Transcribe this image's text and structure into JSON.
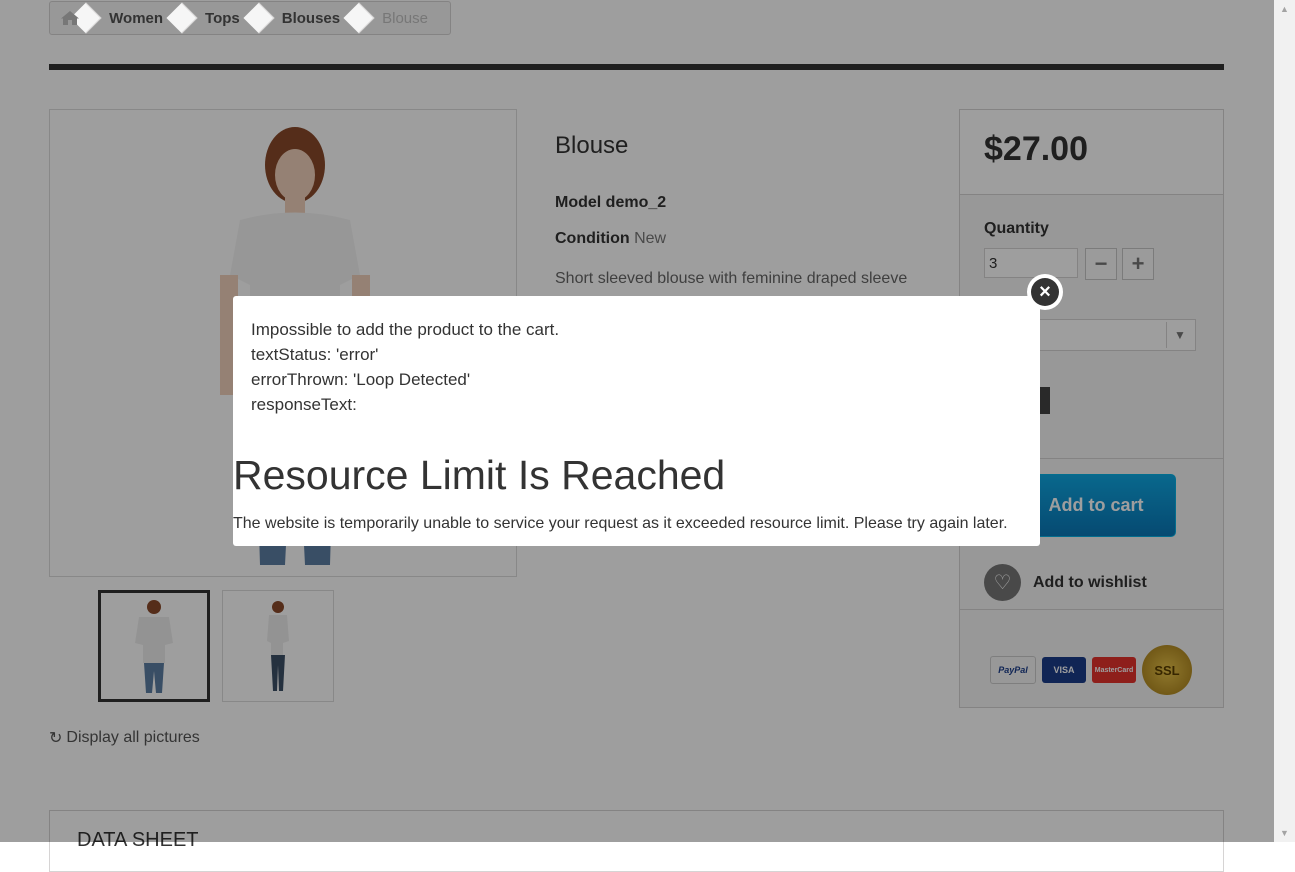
{
  "breadcrumb": {
    "home_icon": "home-icon",
    "items": [
      "Women",
      "Tops",
      "Blouses",
      "Blouse"
    ]
  },
  "product": {
    "title": "Blouse",
    "model_label": "Model",
    "model_value": "demo_2",
    "condition_label": "Condition",
    "condition_value": "New",
    "description": "Short sleeved blouse with feminine draped sleeve"
  },
  "gallery": {
    "display_all": "Display all pictures"
  },
  "buy_box": {
    "price": "$27.00",
    "quantity_label": "Quantity",
    "quantity_value": "3",
    "add_to_cart": "Add to cart",
    "add_to_wishlist": "Add to wishlist",
    "payment_icons": [
      "PayPal",
      "VISA",
      "MasterCard",
      "SSL"
    ]
  },
  "data_sheet": {
    "heading": "DATA SHEET"
  },
  "modal": {
    "message_lines": [
      "Impossible to add the product to the cart.",
      "textStatus: 'error'",
      "errorThrown: 'Loop Detected'",
      "responseText:"
    ],
    "error_title": "Resource Limit Is Reached",
    "error_body": "The website is temporarily unable to service your request as it exceeded resource limit. Please try again later."
  },
  "colors": {
    "overlay": "#000000",
    "add_to_cart": "#0a85c8",
    "accent_dark": "#333333"
  }
}
